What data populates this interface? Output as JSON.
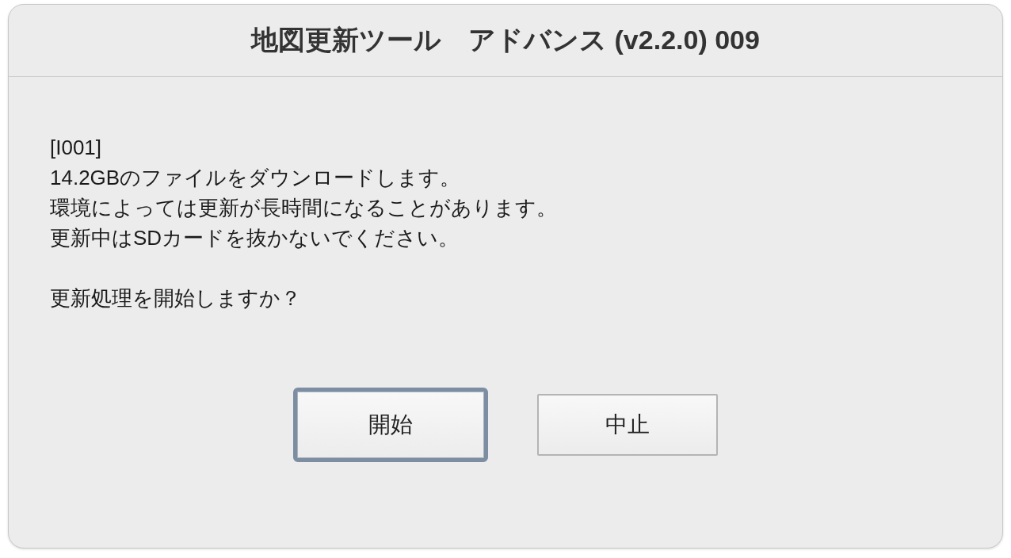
{
  "window": {
    "title": "地図更新ツール　アドバンス (v2.2.0) 009"
  },
  "message": {
    "lines": [
      "[I001]",
      "14.2GBのファイルをダウンロードします。",
      "環境によっては更新が長時間になることがあります。",
      "更新中はSDカードを抜かないでください。"
    ],
    "question": "更新処理を開始しますか？"
  },
  "buttons": [
    {
      "label": "開始",
      "focused": true
    },
    {
      "label": "中止",
      "focused": false
    }
  ]
}
